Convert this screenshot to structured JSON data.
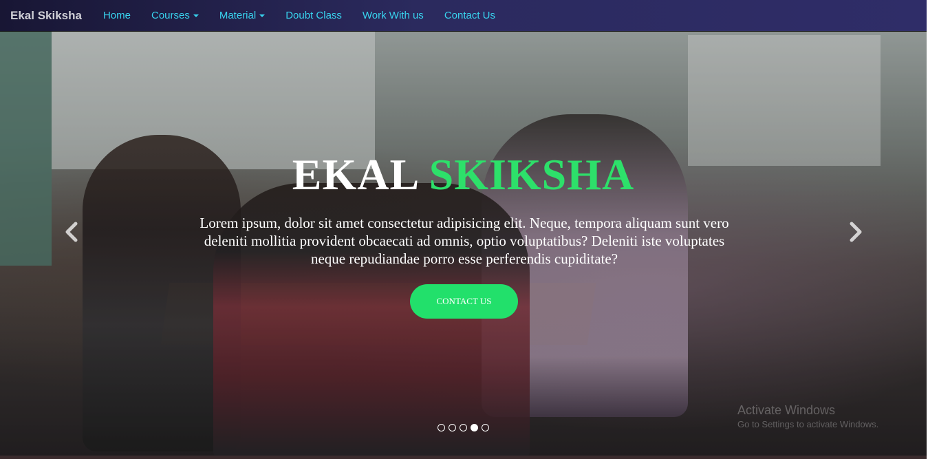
{
  "navbar": {
    "brand": "Ekal Skiksha",
    "items": [
      {
        "label": "Home",
        "dropdown": false
      },
      {
        "label": "Courses",
        "dropdown": true
      },
      {
        "label": "Material",
        "dropdown": true
      },
      {
        "label": "Doubt Class",
        "dropdown": false
      },
      {
        "label": "Work With us",
        "dropdown": false
      },
      {
        "label": "Contact Us",
        "dropdown": false
      }
    ],
    "link_color": "#38d3ee"
  },
  "hero": {
    "title_part1": "EKAL",
    "title_part2": "SKIKSHA",
    "title_accent_color": "#2de06a",
    "text": "Lorem ipsum, dolor sit amet consectetur adipisicing elit. Neque, tempora aliquam sunt vero deleniti mollitia provident obcaecati ad omnis, optio voluptatibus? Deleniti iste voluptates neque repudiandae porro esse perferendis cupiditate?",
    "button_label": "CONTACT US",
    "button_color": "#22e06b",
    "prev_icon": "chevron-left-icon",
    "next_icon": "chevron-right-icon",
    "slides_total": 5,
    "active_slide": 4
  },
  "watermark": {
    "line1": "Activate Windows",
    "line2": "Go to Settings to activate Windows."
  }
}
